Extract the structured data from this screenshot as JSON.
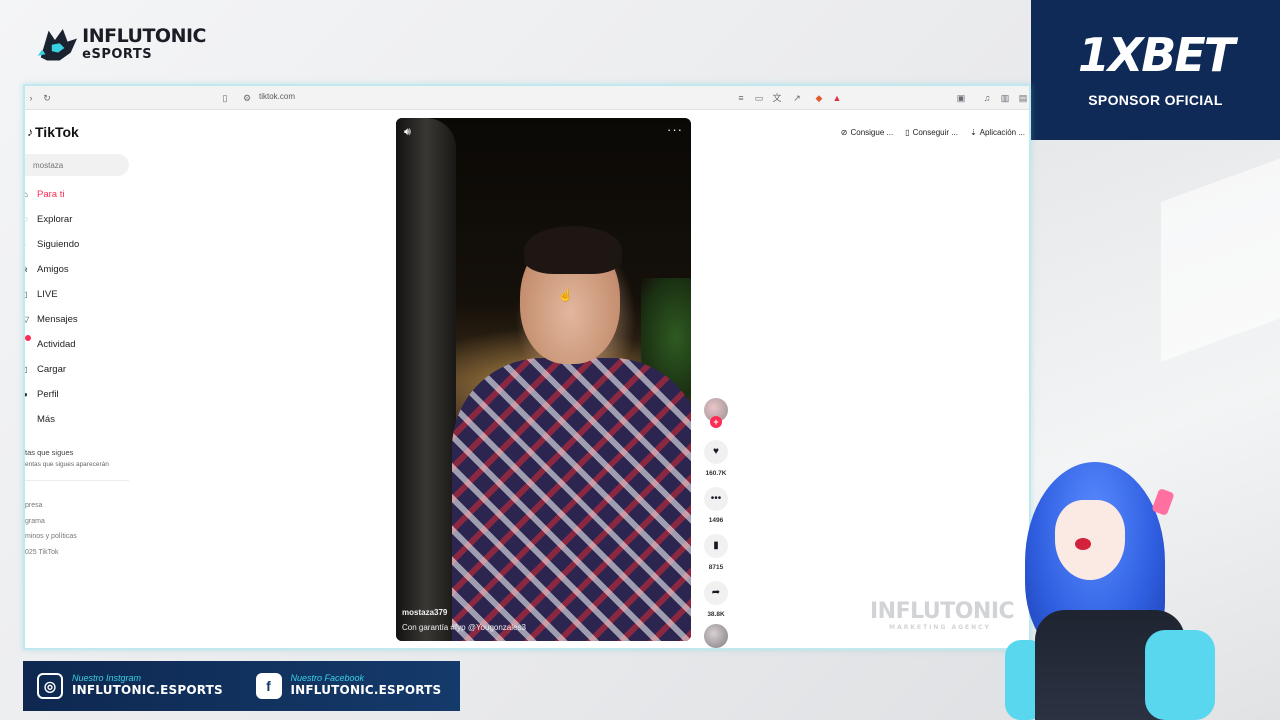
{
  "overlay": {
    "team_line1": "INFLUTONIC",
    "team_line2": "eSPORTS",
    "sponsor_brand": "1XBET",
    "sponsor_sub": "SPONSOR OFICIAL",
    "watermark_main": "INFLUTONIC",
    "watermark_sub": "MARKETING AGENCY",
    "social": [
      {
        "label": "Nuestro Instgram",
        "handle": "INFLUTONIC.ESPORTS",
        "icon": "instagram-icon"
      },
      {
        "label": "Nuestro Facebook",
        "handle": "INFLUTONIC.ESPORTS",
        "icon": "facebook-icon"
      }
    ]
  },
  "browser": {
    "url": "tiktok.com"
  },
  "tiktok": {
    "logo": "TikTok",
    "search_placeholder": "mostaza",
    "nav": [
      {
        "label": "Para ti",
        "icon": "home-icon",
        "active": true
      },
      {
        "label": "Explorar",
        "icon": "compass-icon"
      },
      {
        "label": "Siguiendo",
        "icon": "following-icon"
      },
      {
        "label": "Amigos",
        "icon": "friends-icon"
      },
      {
        "label": "LIVE",
        "icon": "live-icon"
      },
      {
        "label": "Mensajes",
        "icon": "message-icon"
      },
      {
        "label": "Actividad",
        "icon": "activity-icon",
        "badge": true
      },
      {
        "label": "Cargar",
        "icon": "upload-icon"
      },
      {
        "label": "Perfil",
        "icon": "profile-icon"
      },
      {
        "label": "Más",
        "icon": "more-icon"
      }
    ],
    "following_title": "tas que sigues",
    "following_desc": "entas que sigues aparecerán",
    "footer_links": [
      "presa",
      "grama",
      "minos y políticas",
      "025 TikTok"
    ],
    "top_right": [
      "Consigue ...",
      "Conseguir ...",
      "Aplicación ..."
    ],
    "video": {
      "username": "mostaza379",
      "caption": "Con garantía #fyp @Yougonzales3"
    },
    "actions": {
      "likes": "160.7K",
      "comments": "1496",
      "saves": "8715",
      "shares": "38.8K"
    }
  }
}
